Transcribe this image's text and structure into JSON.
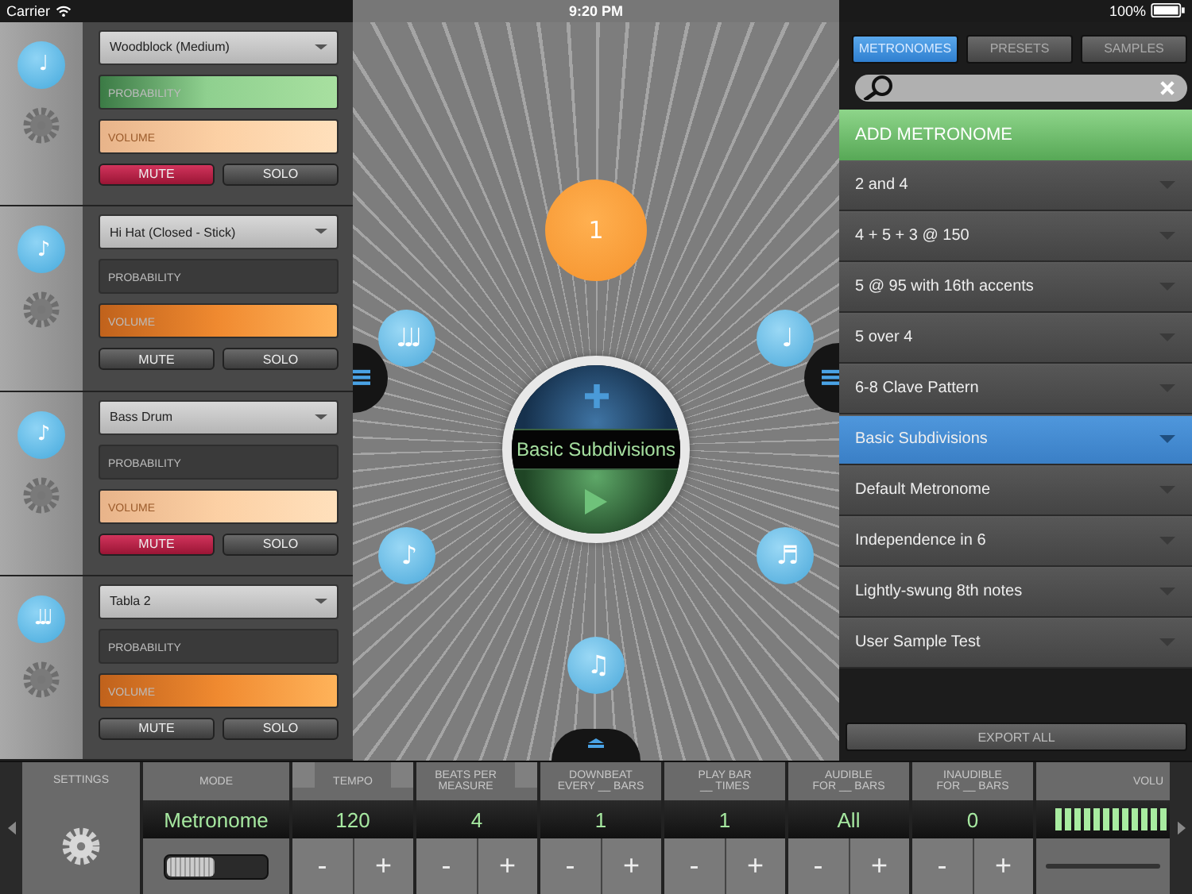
{
  "status_bar": {
    "carrier": "Carrier",
    "time": "9:20 PM",
    "battery": "100%"
  },
  "tracks": [
    {
      "note": "♩",
      "sound": "Woodblock (Medium)",
      "probability": {
        "label": "PROBABILITY",
        "level": 1
      },
      "volume": {
        "label": "VOLUME",
        "level": 1
      },
      "mute": {
        "label": "MUTE",
        "on": true
      },
      "solo": {
        "label": "SOLO",
        "on": false
      }
    },
    {
      "note": "♪",
      "sound": "Hi Hat (Closed - Stick)",
      "probability": {
        "label": "PROBABILITY",
        "level": 0
      },
      "volume": {
        "label": "VOLUME",
        "level": 1
      },
      "mute": {
        "label": "MUTE",
        "on": false
      },
      "solo": {
        "label": "SOLO",
        "on": false
      }
    },
    {
      "note": "♪",
      "sound": "Bass Drum",
      "probability": {
        "label": "PROBABILITY",
        "level": 0
      },
      "volume": {
        "label": "VOLUME",
        "level": 1
      },
      "mute": {
        "label": "MUTE",
        "on": true
      },
      "solo": {
        "label": "SOLO",
        "on": false
      }
    },
    {
      "note": "♩♩♩",
      "sound": "Tabla 2",
      "probability": {
        "label": "PROBABILITY",
        "level": 0
      },
      "volume": {
        "label": "VOLUME",
        "level": 1
      },
      "mute": {
        "label": "MUTE",
        "on": false
      },
      "solo": {
        "label": "SOLO",
        "on": false
      }
    }
  ],
  "wheel": {
    "preset_name": "Basic Subdivisions",
    "beats": [
      {
        "kind": "accent",
        "label": "1"
      },
      {
        "kind": "note",
        "label": "♩"
      },
      {
        "kind": "note",
        "label": "♬"
      },
      {
        "kind": "note",
        "label": "♫"
      },
      {
        "kind": "note",
        "label": "♪"
      },
      {
        "kind": "note",
        "label": "♩♩♩"
      }
    ]
  },
  "library": {
    "tabs": [
      {
        "label": "METRONOMES",
        "selected": true
      },
      {
        "label": "PRESETS",
        "selected": false
      },
      {
        "label": "SAMPLES",
        "selected": false
      }
    ],
    "add_button": "ADD METRONOME",
    "items": [
      {
        "name": "2 and 4",
        "selected": false
      },
      {
        "name": "4 + 5 + 3 @ 150",
        "selected": false
      },
      {
        "name": "5 @ 95 with 16th accents",
        "selected": false
      },
      {
        "name": "5 over 4",
        "selected": false
      },
      {
        "name": "6-8 Clave Pattern",
        "selected": false
      },
      {
        "name": "Basic Subdivisions",
        "selected": true
      },
      {
        "name": "Default Metronome",
        "selected": false
      },
      {
        "name": "Independence in 6",
        "selected": false
      },
      {
        "name": "Lightly-swung 8th notes",
        "selected": false
      },
      {
        "name": "User Sample Test",
        "selected": false
      }
    ],
    "export_button": "EXPORT ALL"
  },
  "bottom": {
    "settings_label": "SETTINGS",
    "mode": {
      "label": "MODE",
      "value": "Metronome",
      "switch_on": false
    },
    "params": [
      {
        "label": "TEMPO",
        "value": "120",
        "decrement": "-",
        "increment": "+"
      },
      {
        "label": "BEATS PER\nMEASURE",
        "value": "4",
        "decrement": "-",
        "increment": "+"
      },
      {
        "label": "DOWNBEAT\nEVERY __ BARS",
        "value": "1",
        "decrement": "-",
        "increment": "+"
      },
      {
        "label": "PLAY BAR\n__ TIMES",
        "value": "1",
        "decrement": "-",
        "increment": "+"
      },
      {
        "label": "AUDIBLE\nFOR __ BARS",
        "value": "All",
        "decrement": "-",
        "increment": "+"
      },
      {
        "label": "INAUDIBLE\nFOR __ BARS",
        "value": "0",
        "decrement": "-",
        "increment": "+"
      }
    ],
    "volume": {
      "label": "VOLU",
      "level": 1
    }
  }
}
